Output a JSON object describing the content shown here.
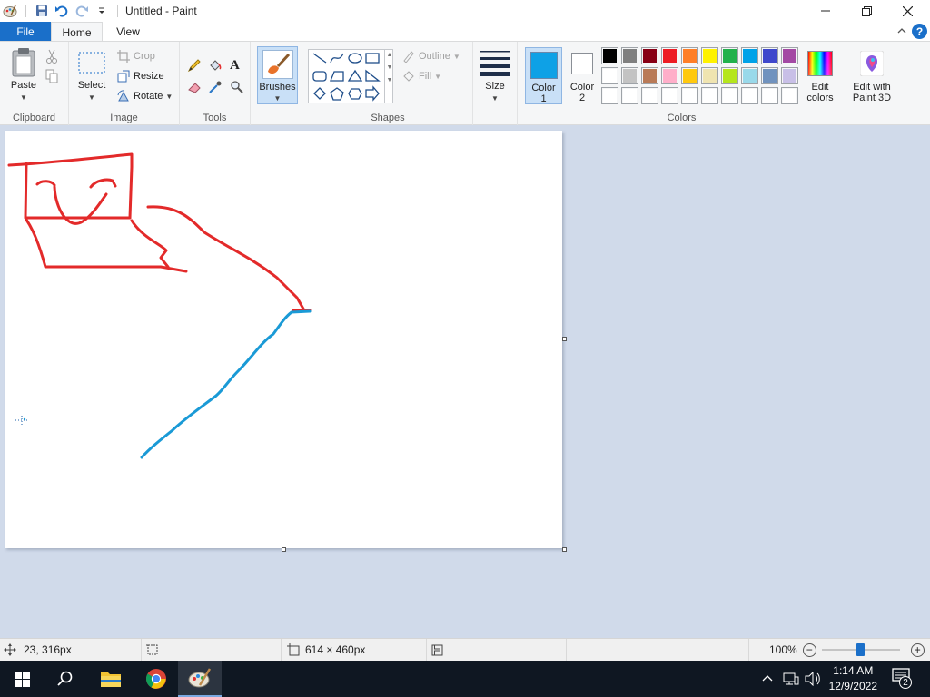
{
  "window": {
    "title": "Untitled - Paint"
  },
  "tabs": {
    "file": "File",
    "home": "Home",
    "view": "View"
  },
  "ribbon": {
    "clipboard": {
      "paste": "Paste",
      "label": "Clipboard"
    },
    "image": {
      "select": "Select",
      "crop": "Crop",
      "resize": "Resize",
      "rotate": "Rotate",
      "label": "Image"
    },
    "tools": {
      "label": "Tools"
    },
    "brushes": {
      "label": "Brushes"
    },
    "shapes": {
      "outline": "Outline",
      "fill": "Fill",
      "label": "Shapes"
    },
    "size": {
      "label": "Size"
    },
    "colors": {
      "color1": "Color\n1",
      "color1_a": "Color",
      "color1_b": "1",
      "color2_a": "Color",
      "color2_b": "2",
      "edit_a": "Edit",
      "edit_b": "colors",
      "label": "Colors",
      "color1_value": "#0ea1e6",
      "color2_value": "#ffffff",
      "palette_row1": [
        "#000000",
        "#7f7f7f",
        "#880015",
        "#ed1c24",
        "#ff7f27",
        "#fff200",
        "#22b14c",
        "#00a2e8",
        "#3f48cc",
        "#a349a4"
      ],
      "palette_row2": [
        "#ffffff",
        "#c3c3c3",
        "#b97a57",
        "#ffaec9",
        "#ffc90e",
        "#efe4b0",
        "#b5e61d",
        "#99d9ea",
        "#7092be",
        "#c8bfe7"
      ],
      "palette_row3": [
        "#ffffff",
        "#ffffff",
        "#ffffff",
        "#ffffff",
        "#ffffff",
        "#ffffff",
        "#ffffff",
        "#ffffff",
        "#ffffff",
        "#ffffff"
      ]
    },
    "paint3d": {
      "line1": "Edit with",
      "line2": "Paint 3D"
    }
  },
  "statusbar": {
    "cursor_pos": "23, 316px",
    "canvas_size": "614 × 460px",
    "zoom": "100%"
  },
  "taskbar": {
    "time": "1:14 AM",
    "date": "12/9/2022",
    "notification_count": "2"
  }
}
